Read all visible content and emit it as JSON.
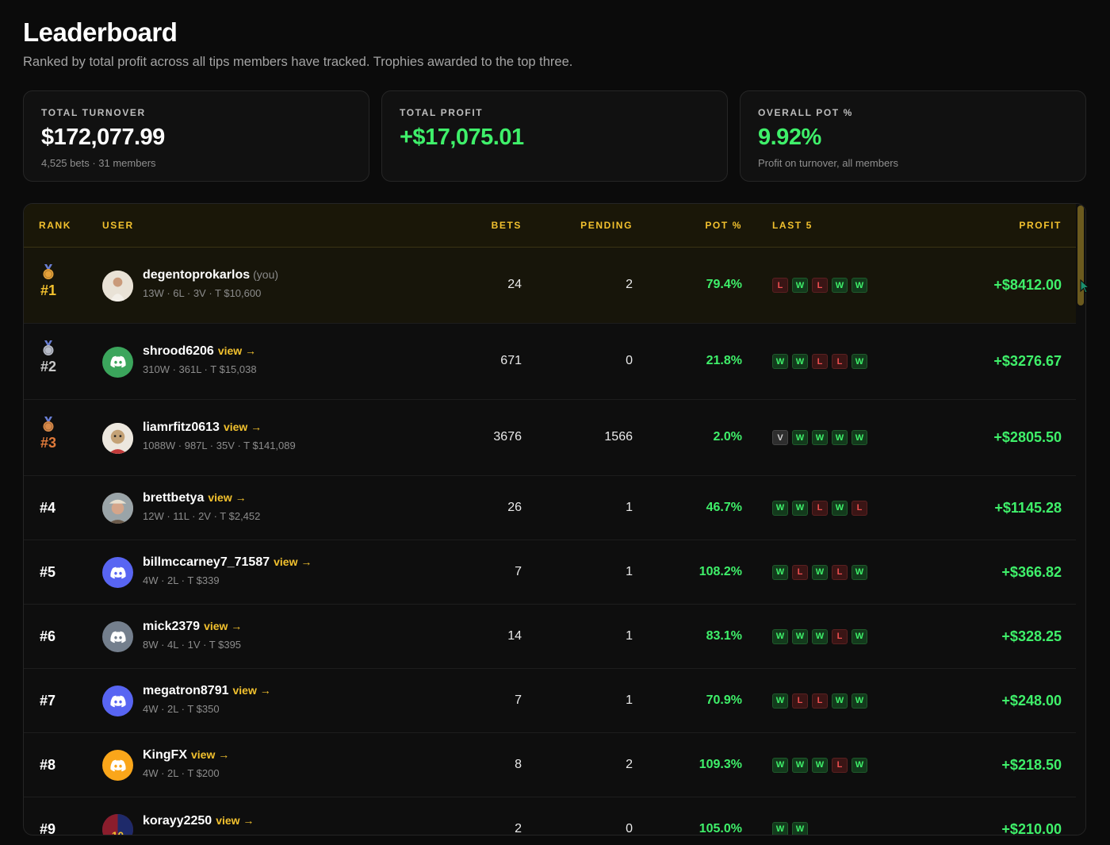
{
  "page": {
    "title": "Leaderboard",
    "subtitle": "Ranked by total profit across all tips members have tracked. Trophies awarded to the top three."
  },
  "stats": [
    {
      "label": "TOTAL TURNOVER",
      "value": "$172,077.99",
      "sub": "4,525 bets · 31 members"
    },
    {
      "label": "TOTAL PROFIT",
      "value": "+$17,075.01",
      "sub": ""
    },
    {
      "label": "OVERALL POT %",
      "value": "9.92%",
      "sub": "Profit on turnover, all members"
    }
  ],
  "table": {
    "headers": {
      "rank": "RANK",
      "user": "USER",
      "bets": "BETS",
      "pending": "PENDING",
      "pot": "POT %",
      "last5": "LAST 5",
      "profit": "PROFIT"
    },
    "you_label": "(you)",
    "view_label": "view →",
    "rows": [
      {
        "rank": "#1",
        "medal": "1",
        "name": "degentoprokarlos",
        "you": true,
        "stats": "13W · 6L · 3V · T $10,600",
        "bets": "24",
        "pending": "2",
        "pot": "79.4%",
        "last5": [
          "L",
          "W",
          "L",
          "W",
          "W"
        ],
        "profit": "+$8412.00",
        "avatar": "photo-person",
        "avatar_color": "#d8c9b6"
      },
      {
        "rank": "#2",
        "medal": "2",
        "name": "shrood6206",
        "you": false,
        "stats": "310W · 361L · T $15,038",
        "bets": "671",
        "pending": "0",
        "pot": "21.8%",
        "last5": [
          "W",
          "W",
          "L",
          "L",
          "W"
        ],
        "profit": "+$3276.67",
        "avatar": "discord-icon",
        "avatar_color": "#3ba55c"
      },
      {
        "rank": "#3",
        "medal": "3",
        "name": "liamrfitz0613",
        "you": false,
        "stats": "1088W · 987L · 35V · T $141,089",
        "bets": "3676",
        "pending": "1566",
        "pot": "2.0%",
        "last5": [
          "V",
          "W",
          "W",
          "W",
          "W"
        ],
        "profit": "+$2805.50",
        "avatar": "photo-ape",
        "avatar_color": "#e6dccb"
      },
      {
        "rank": "#4",
        "medal": "",
        "name": "brettbetya",
        "you": false,
        "stats": "12W · 11L · 2V · T $2,452",
        "bets": "26",
        "pending": "1",
        "pot": "46.7%",
        "last5": [
          "W",
          "W",
          "L",
          "W",
          "L"
        ],
        "profit": "+$1145.28",
        "avatar": "photo-person-hat",
        "avatar_color": "#b89a84"
      },
      {
        "rank": "#5",
        "medal": "",
        "name": "billmccarney7_71587",
        "you": false,
        "stats": "4W · 2L · T $339",
        "bets": "7",
        "pending": "1",
        "pot": "108.2%",
        "last5": [
          "W",
          "L",
          "W",
          "L",
          "W"
        ],
        "profit": "+$366.82",
        "avatar": "discord-icon",
        "avatar_color": "#5865f2"
      },
      {
        "rank": "#6",
        "medal": "",
        "name": "mick2379",
        "you": false,
        "stats": "8W · 4L · 1V · T $395",
        "bets": "14",
        "pending": "1",
        "pot": "83.1%",
        "last5": [
          "W",
          "W",
          "W",
          "L",
          "W"
        ],
        "profit": "+$328.25",
        "avatar": "discord-icon",
        "avatar_color": "#747f8d"
      },
      {
        "rank": "#7",
        "medal": "",
        "name": "megatron8791",
        "you": false,
        "stats": "4W · 2L · T $350",
        "bets": "7",
        "pending": "1",
        "pot": "70.9%",
        "last5": [
          "W",
          "L",
          "L",
          "W",
          "W"
        ],
        "profit": "+$248.00",
        "avatar": "discord-icon",
        "avatar_color": "#5865f2"
      },
      {
        "rank": "#8",
        "medal": "",
        "name": "KingFX",
        "you": false,
        "stats": "4W · 2L · T $200",
        "bets": "8",
        "pending": "2",
        "pot": "109.3%",
        "last5": [
          "W",
          "W",
          "W",
          "L",
          "W"
        ],
        "profit": "+$218.50",
        "avatar": "discord-icon",
        "avatar_color": "#faa61a"
      },
      {
        "rank": "#9",
        "medal": "",
        "name": "korayy2250",
        "you": false,
        "stats": "",
        "bets": "2",
        "pending": "0",
        "pot": "105.0%",
        "last5": [
          "W",
          "W"
        ],
        "profit": "+$210.00",
        "avatar": "photo-jersey",
        "avatar_color": "#8b1d2c"
      }
    ]
  }
}
